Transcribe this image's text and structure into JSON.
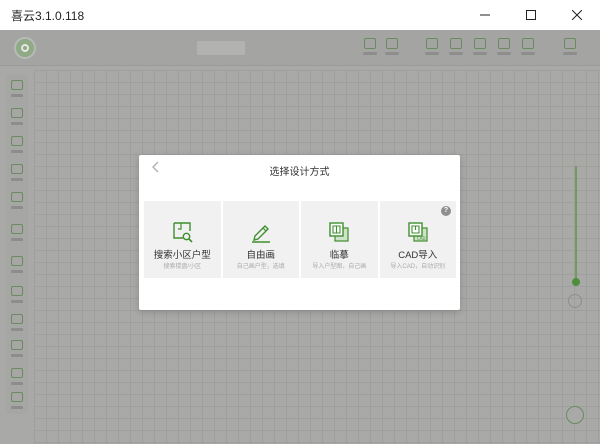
{
  "window": {
    "title": "喜云3.1.0.118",
    "minimize_icon": "minimize-icon",
    "maximize_icon": "maximize-icon",
    "close_icon": "close-icon"
  },
  "dialog": {
    "title": "选择设计方式",
    "back_icon": "chevron-left-icon",
    "options": [
      {
        "icon": "search-floorplan-icon",
        "name": "搜索小区户型",
        "desc": "搜索楼盘/小区"
      },
      {
        "icon": "pencil-draw-icon",
        "name": "自由画",
        "desc": "自己画户型，选填"
      },
      {
        "icon": "trace-icon",
        "name": "临摹",
        "desc": "导入户型图，自己画"
      },
      {
        "icon": "cad-import-icon",
        "name": "CAD导入",
        "desc": "导入CAD，自动识别",
        "help": "?"
      }
    ]
  },
  "colors": {
    "accent_green": "#3f8f2f",
    "overlay": "#a9aaa8"
  }
}
